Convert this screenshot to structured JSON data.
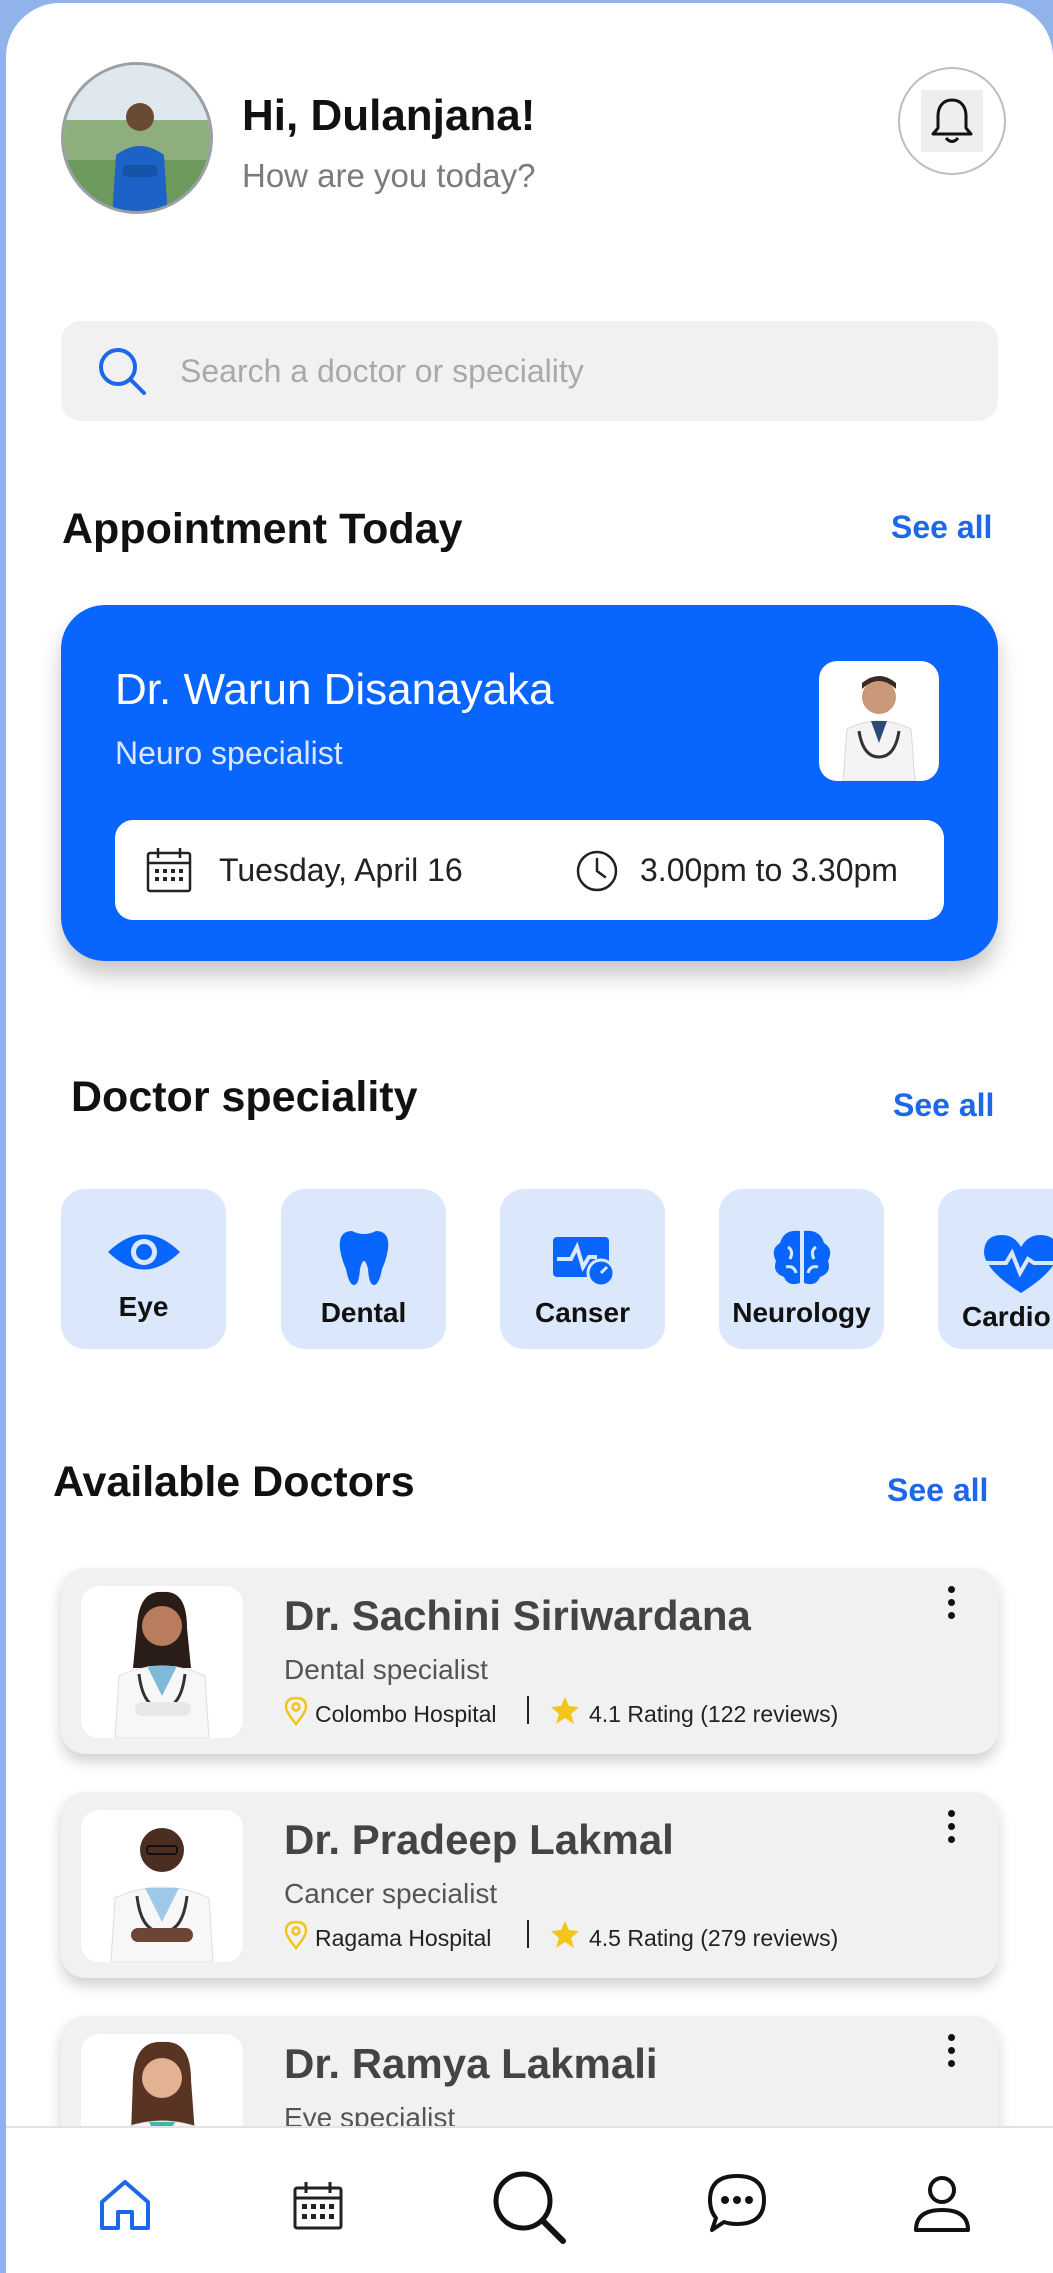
{
  "header": {
    "greeting": "Hi, Dulanjana!",
    "subtitle": "How are you today?"
  },
  "search": {
    "placeholder": "Search a doctor or speciality"
  },
  "appointment_section": {
    "title": "Appointment Today",
    "see_all": "See all"
  },
  "appointment": {
    "doctor": "Dr. Warun Disanayaka",
    "speciality": "Neuro specialist",
    "date": "Tuesday, April 16",
    "time": "3.00pm to 3.30pm"
  },
  "speciality_section": {
    "title": "Doctor speciality",
    "see_all": "See all"
  },
  "specialities": [
    {
      "label": "Eye",
      "icon": "eye-icon"
    },
    {
      "label": "Dental",
      "icon": "tooth-icon"
    },
    {
      "label": "Canser",
      "icon": "monitor-pulse-icon"
    },
    {
      "label": "Neurology",
      "icon": "brain-icon"
    },
    {
      "label": "Cardio",
      "icon": "heart-pulse-icon"
    }
  ],
  "doctors_section": {
    "title": "Available Doctors",
    "see_all": "See all"
  },
  "doctors": [
    {
      "name": "Dr. Sachini Siriwardana",
      "speciality": "Dental specialist",
      "hospital": "Colombo Hospital",
      "rating": "4.1 Rating (122 reviews)"
    },
    {
      "name": "Dr. Pradeep Lakmal",
      "speciality": "Cancer specialist",
      "hospital": "Ragama Hospital",
      "rating": "4.5 Rating (279 reviews)"
    },
    {
      "name": "Dr. Ramya Lakmali",
      "speciality": "Eye specialist",
      "hospital": "",
      "rating": ""
    }
  ],
  "nav": {
    "items": [
      {
        "icon": "home-icon",
        "active": true
      },
      {
        "icon": "calendar-icon",
        "active": false
      },
      {
        "icon": "search-icon",
        "active": false
      },
      {
        "icon": "chat-icon",
        "active": false
      },
      {
        "icon": "profile-icon",
        "active": false
      }
    ]
  },
  "colors": {
    "accent": "#0866ff",
    "link": "#1c68e8",
    "card_tint": "#dbe8fb",
    "star": "#f5c518",
    "pin": "#f0c419"
  }
}
